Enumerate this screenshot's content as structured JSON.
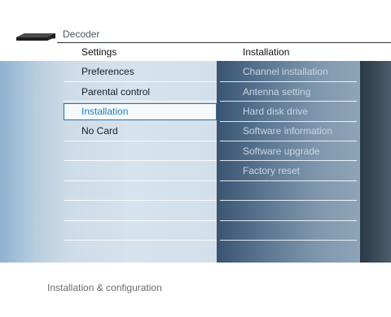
{
  "header": {
    "title": "Decoder",
    "left_column": "Settings",
    "right_column": "Installation"
  },
  "settings_menu": [
    {
      "label": "Preferences",
      "selected": false
    },
    {
      "label": "Parental control",
      "selected": false
    },
    {
      "label": "Installation",
      "selected": true
    },
    {
      "label": "No Card",
      "selected": false
    }
  ],
  "installation_menu": [
    {
      "label": "Channel installation"
    },
    {
      "label": "Antenna setting"
    },
    {
      "label": "Hard disk drive"
    },
    {
      "label": "Software information"
    },
    {
      "label": "Software upgrade"
    },
    {
      "label": "Factory reset"
    }
  ],
  "status": {
    "description": "Installation & configuration"
  },
  "colors": {
    "selected_text": "#1f7fbf",
    "selected_border": "#2c6f9d",
    "left_panel": "#cddce8",
    "right_panel": "#5d7893"
  },
  "icons": {
    "device": "decoder-device-icon"
  }
}
